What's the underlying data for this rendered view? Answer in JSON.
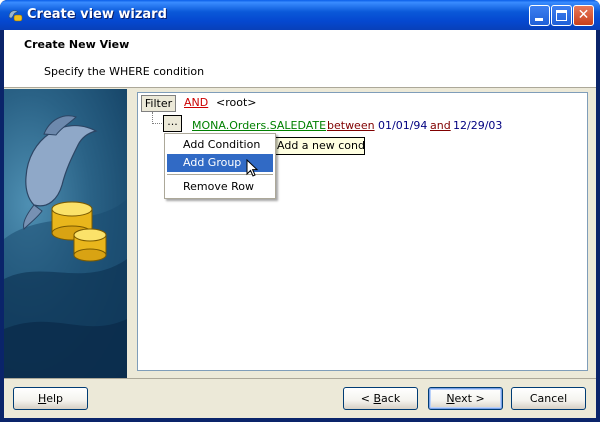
{
  "window": {
    "title": "Create view wizard",
    "icon": "dolphin-icon",
    "controls": [
      "minimize",
      "maximize",
      "close"
    ]
  },
  "header": {
    "title": "Create New View",
    "subtitle": "Specify the WHERE condition"
  },
  "sidebar": {
    "image": "dolphin-database-illustration"
  },
  "filter": {
    "button_label": "Filter",
    "root_operator": "AND",
    "root_label": "<root>",
    "row_button_label": "...",
    "condition": {
      "field": "MONA.Orders.SALEDATE",
      "operator": "between",
      "value1": "01/01/94",
      "joiner": "and",
      "value2": "12/29/03"
    }
  },
  "tooltip": {
    "text": "Add a new condition"
  },
  "context_menu": {
    "items": [
      {
        "label": "Add Condition",
        "highlighted": false
      },
      {
        "label": "Add Group",
        "highlighted": true
      },
      {
        "label": "Remove Row",
        "highlighted": false
      }
    ]
  },
  "footer": {
    "help_prefix": "",
    "help_mnemonic": "H",
    "help_rest": "elp",
    "back_prefix": "< ",
    "back_mnemonic": "B",
    "back_rest": "ack",
    "next_prefix": "",
    "next_mnemonic": "N",
    "next_rest": "ext >",
    "cancel_label": "Cancel"
  },
  "colors": {
    "titlebar": "#0a58d8",
    "menu_highlight": "#316ac5",
    "operator_red": "#cc0000",
    "field_green": "#008000",
    "value_navy": "#000080"
  }
}
